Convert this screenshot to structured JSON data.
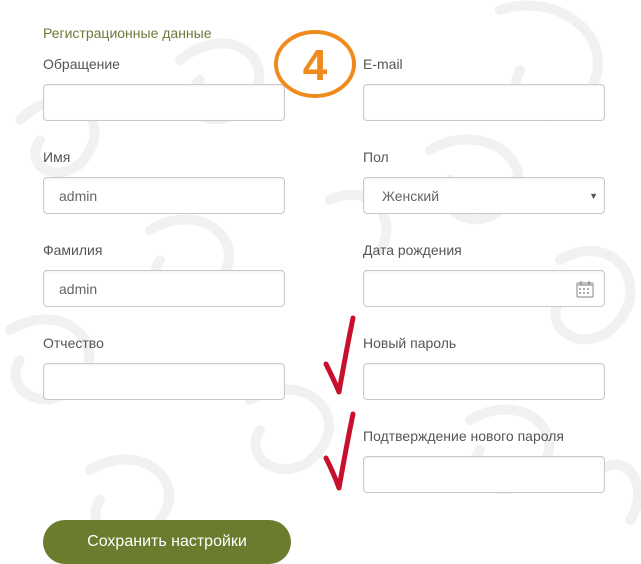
{
  "form": {
    "section_title": "Регистрационные данные",
    "fields": {
      "salutation": {
        "label": "Обращение",
        "value": ""
      },
      "email": {
        "label": "E-mail",
        "value": ""
      },
      "first_name": {
        "label": "Имя",
        "value": "admin"
      },
      "gender": {
        "label": "Пол",
        "selected": "Женский"
      },
      "last_name": {
        "label": "Фамилия",
        "value": "admin"
      },
      "birth_date": {
        "label": "Дата рождения",
        "value": ""
      },
      "middle_name": {
        "label": "Отчество",
        "value": ""
      },
      "new_password": {
        "label": "Новый пароль",
        "value": ""
      },
      "confirm_password": {
        "label": "Подтверждение нового пароля",
        "value": ""
      }
    },
    "save_label": "Сохранить настройки"
  },
  "annotation": {
    "step_number": "4",
    "accent_color": "#f08a1c",
    "check_color": "#c8102e"
  },
  "colors": {
    "title": "#6b7a3a",
    "button": "#6c7c2e"
  }
}
